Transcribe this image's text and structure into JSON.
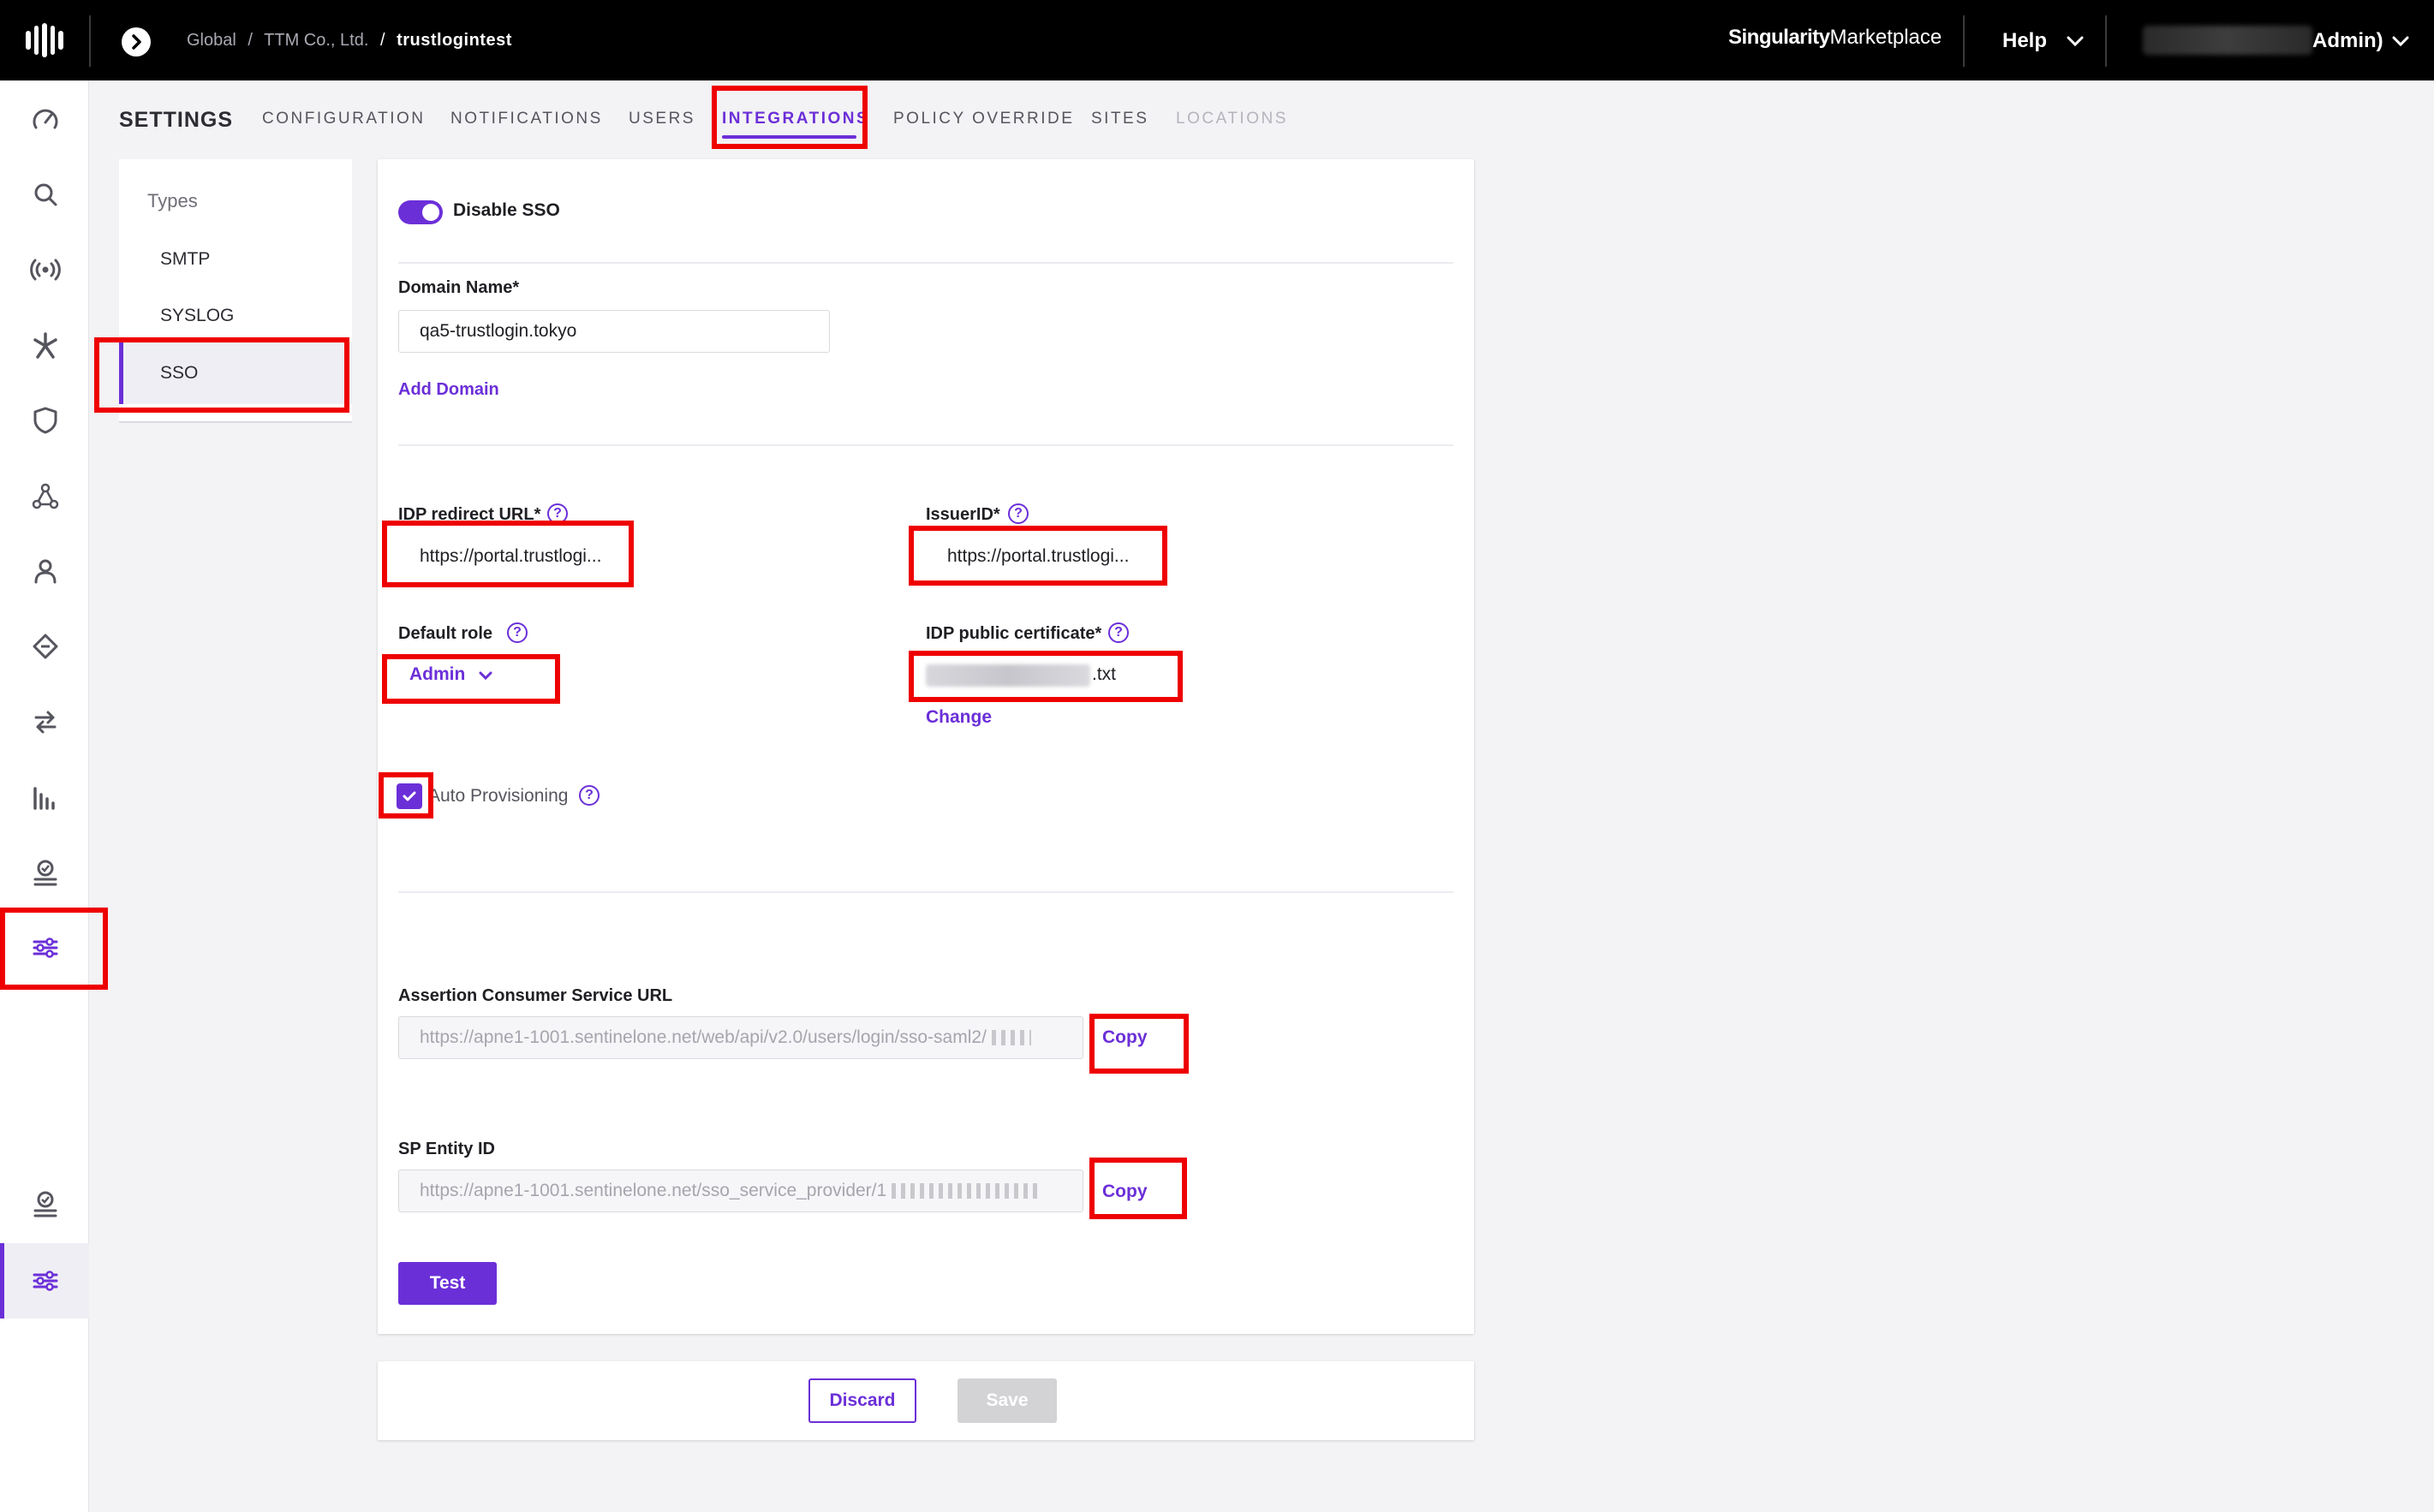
{
  "topbar": {
    "breadcrumb": [
      "Global",
      "TTM Co., Ltd.",
      "trustlogintest"
    ],
    "breadcrumb_sep": "/",
    "marketplace_brand": "Singularity",
    "marketplace_label": "Marketplace",
    "help_label": "Help",
    "user_role": "Admin)"
  },
  "settings": {
    "title": "SETTINGS",
    "tabs": [
      "CONFIGURATION",
      "NOTIFICATIONS",
      "USERS",
      "INTEGRATIONS",
      "POLICY OVERRIDE",
      "SITES",
      "LOCATIONS"
    ],
    "active_tab": "INTEGRATIONS"
  },
  "types": {
    "title": "Types",
    "items": [
      "SMTP",
      "SYSLOG",
      "SSO"
    ],
    "active": "SSO"
  },
  "sso": {
    "disable_label": "Disable SSO",
    "domain_label": "Domain Name*",
    "domain_value": "qa5-trustlogin.tokyo",
    "add_domain": "Add Domain",
    "idp_redirect_label": "IDP redirect URL*",
    "idp_redirect_value": "https://portal.trustlogi...",
    "issuer_label": "IssuerID*",
    "issuer_value": "https://portal.trustlogi...",
    "default_role_label": "Default role",
    "default_role_value": "Admin",
    "cert_label": "IDP public certificate*",
    "cert_value": ".txt",
    "change_link": "Change",
    "auto_prov_label": "Auto Provisioning",
    "acs_label": "Assertion Consumer Service URL",
    "acs_value": "https://apne1-1001.sentinelone.net/web/api/v2.0/users/login/sso-saml2/",
    "copy_label": "Copy",
    "sp_label": "SP Entity ID",
    "sp_value": "https://apne1-1001.sentinelone.net/sso_service_provider/1",
    "test_label": "Test",
    "help_glyph": "?"
  },
  "footer": {
    "discard_label": "Discard",
    "save_label": "Save"
  },
  "colors": {
    "accent": "#6b2fd8",
    "annotation": "#ee0000",
    "topbar": "#000000"
  },
  "icons": [
    "logo-icon",
    "expand-icon",
    "chevron-down-icon",
    "dashboard-icon",
    "search-icon",
    "broadcast-icon",
    "sparkle-icon",
    "shield-icon",
    "graph-icon",
    "user-icon",
    "diamond-icon",
    "sync-icon",
    "chart-icon",
    "stamp-icon",
    "sliders-icon",
    "help-icon",
    "checkmark-icon"
  ]
}
